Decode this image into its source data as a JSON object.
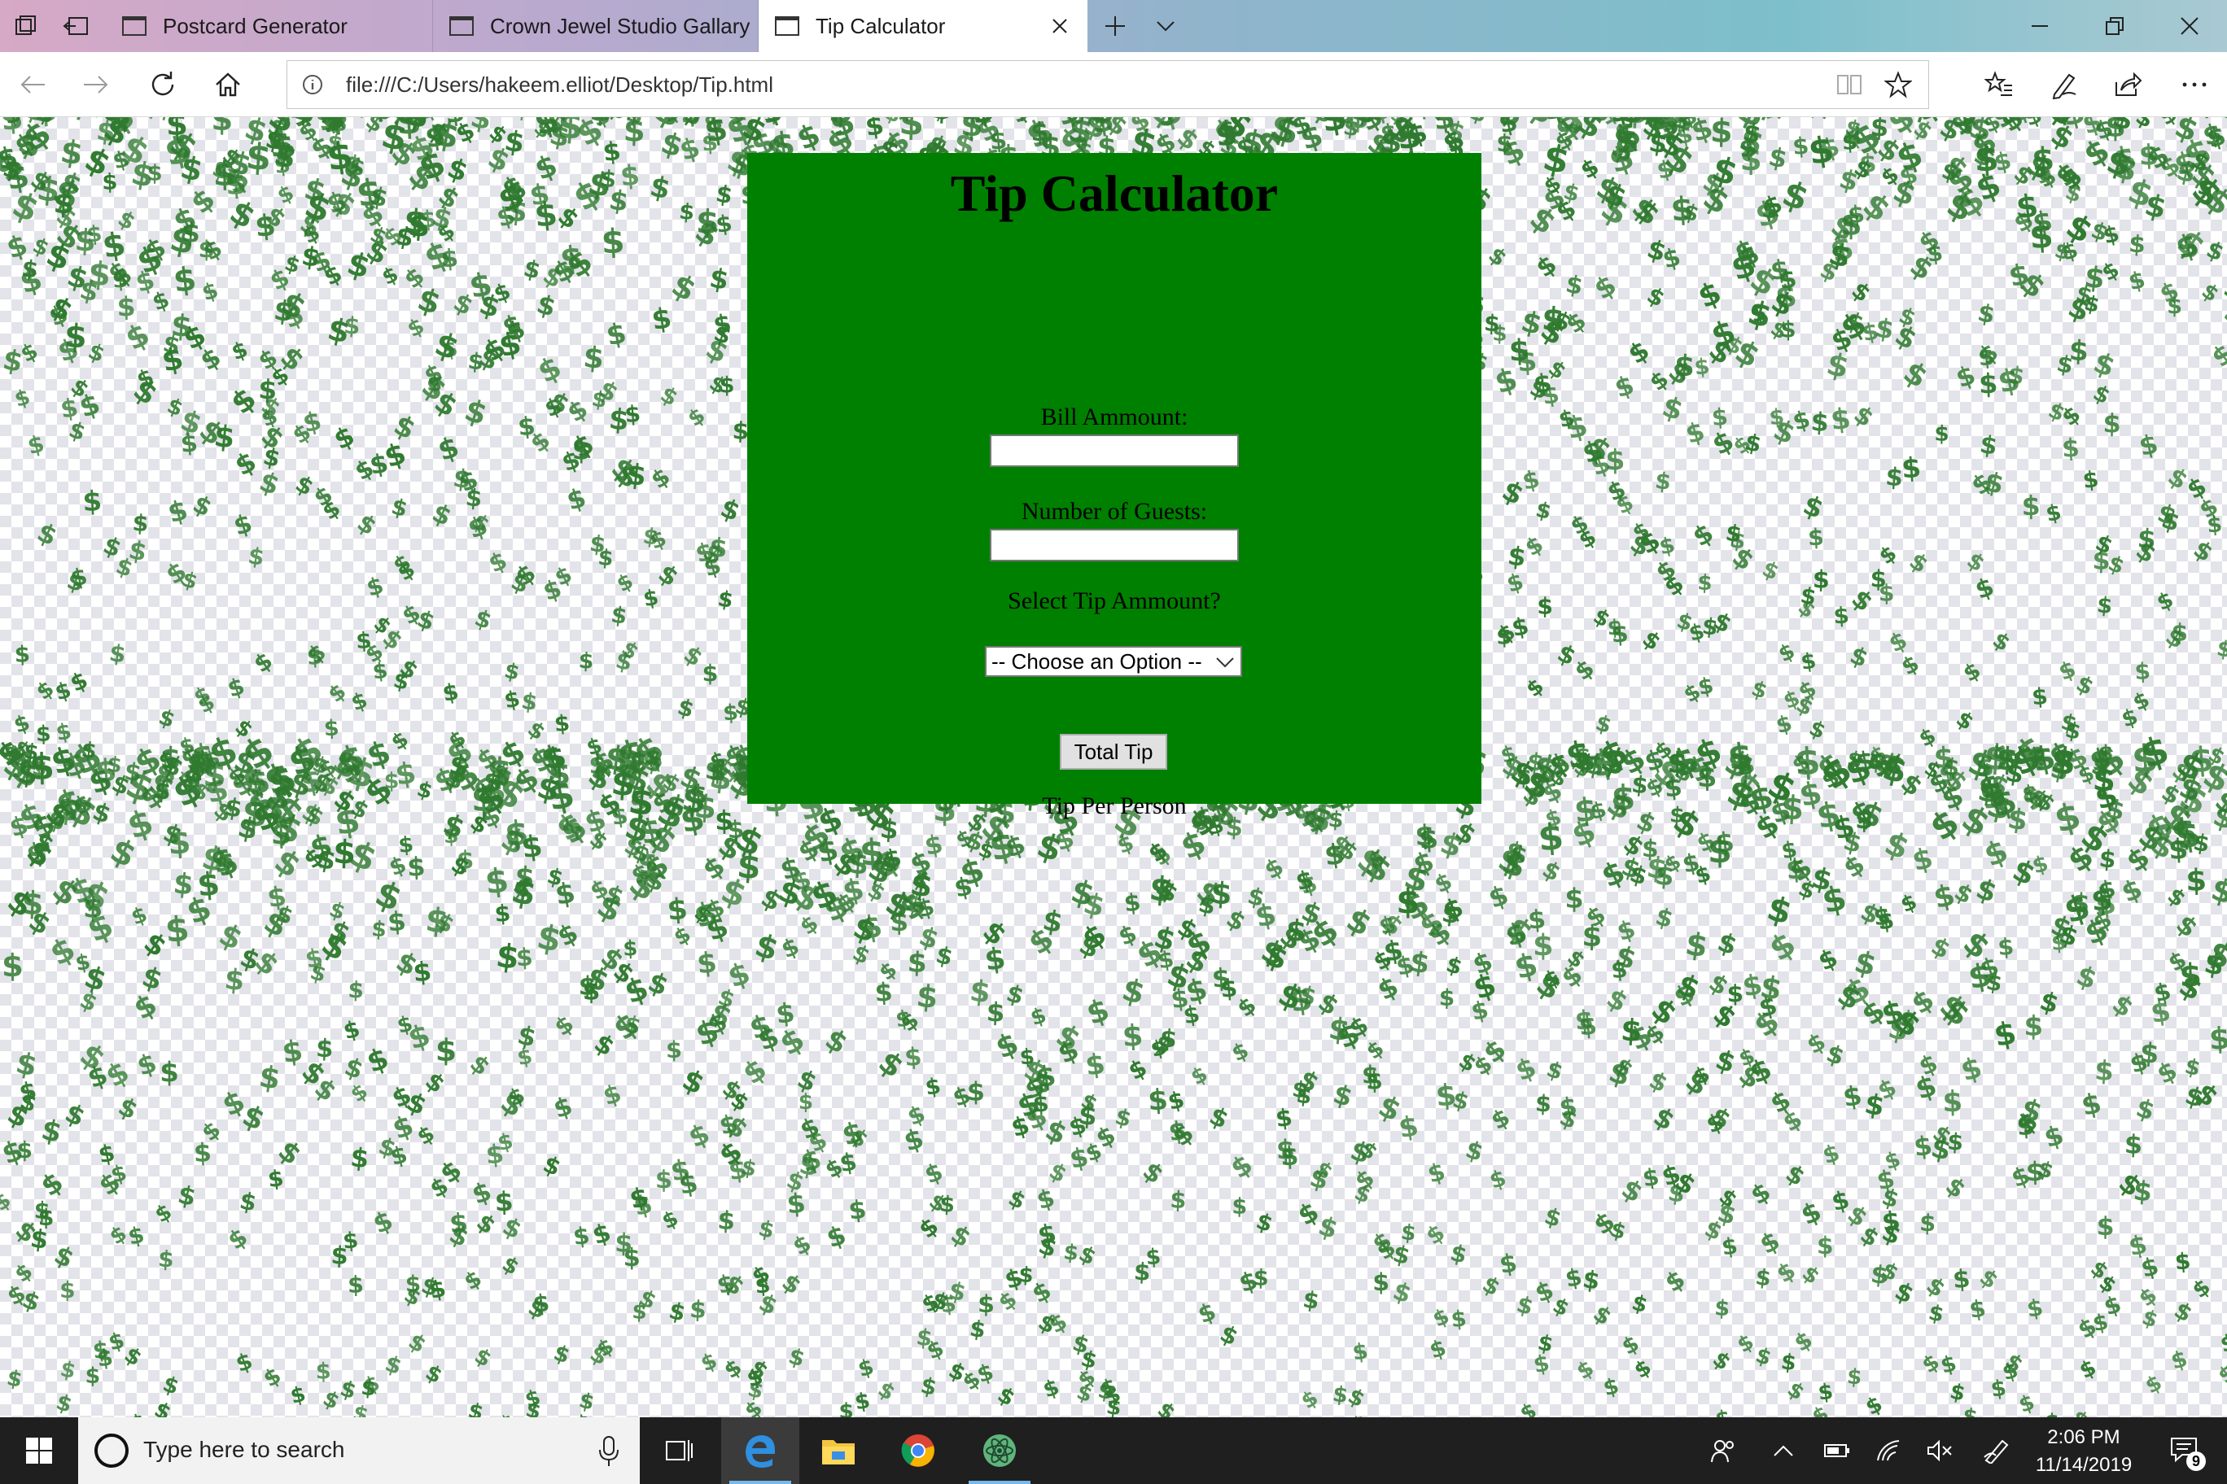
{
  "browser": {
    "tabs": [
      {
        "title": "Postcard Generator",
        "active": false
      },
      {
        "title": "Crown Jewel Studio Gallary",
        "active": false
      },
      {
        "title": "Tip Calculator",
        "active": true
      }
    ],
    "address": "file:///C:/Users/hakeem.elliot/Desktop/Tip.html"
  },
  "calculator": {
    "title": "Tip Calculator",
    "bill_label": "Bill Ammount:",
    "bill_value": "",
    "guests_label": "Number of Guests:",
    "guests_value": "",
    "tip_label": "Select Tip Ammount?",
    "tip_selected": "-- Choose an Option --",
    "button_label": "Total Tip",
    "result_label": "Tip Per Person",
    "panel_color": "#008000"
  },
  "taskbar": {
    "search_placeholder": "Type here to search",
    "time": "2:06 PM",
    "date": "11/14/2019",
    "notification_count": "9",
    "apps": [
      "task-view",
      "edge",
      "file-explorer",
      "chrome",
      "atom"
    ]
  },
  "colors": {
    "dollar_green": "#2f7a2f",
    "taskbar": "#1f1f1f",
    "edge_blue": "#0078d7"
  }
}
